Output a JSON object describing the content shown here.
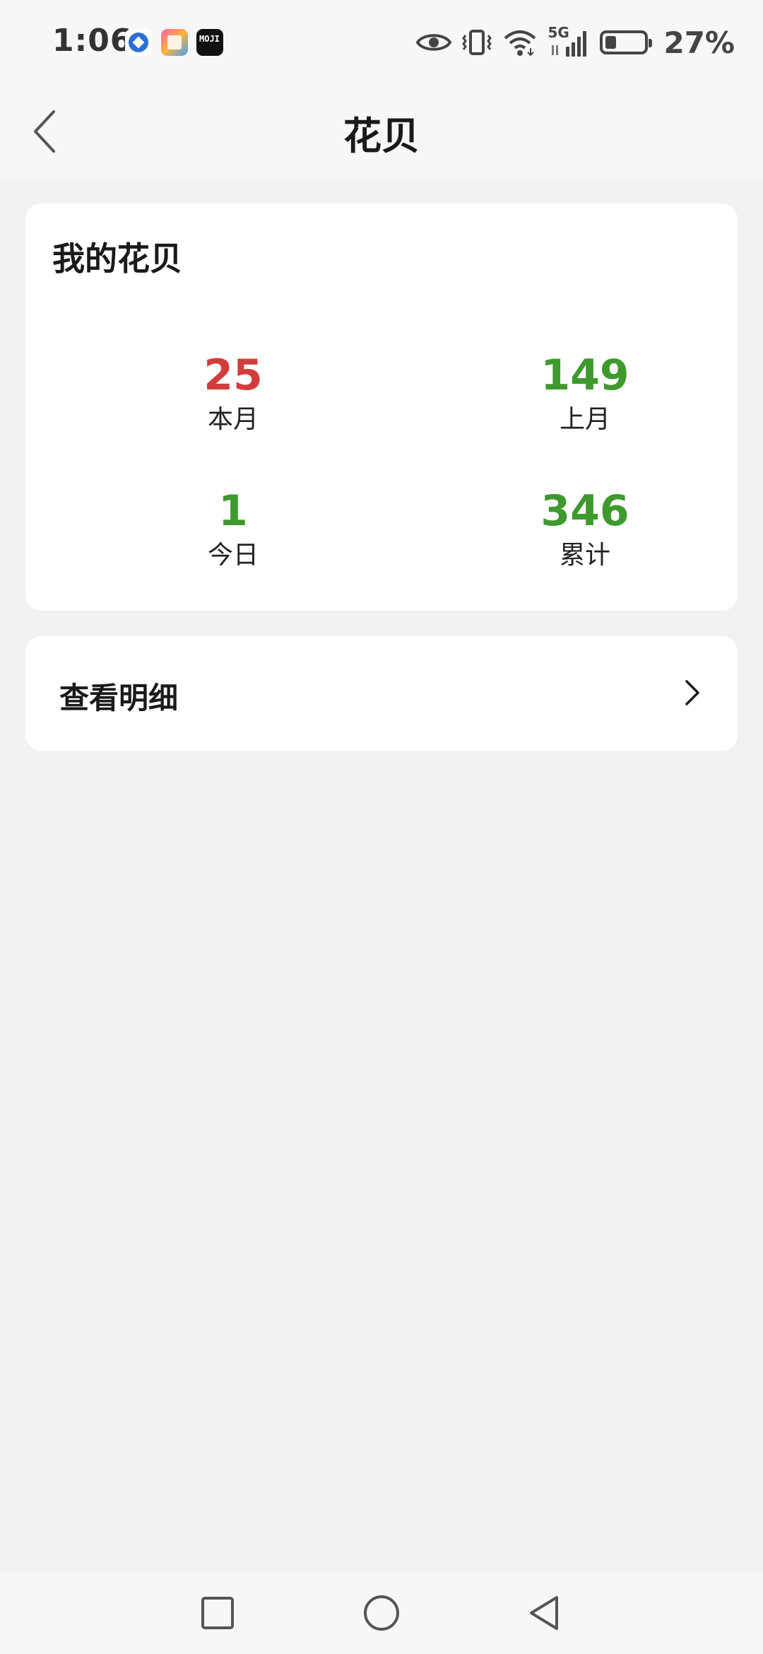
{
  "status_bar": {
    "time": "1:06",
    "network": "5G",
    "battery_text": "27%",
    "battery_level": 0.27,
    "app_badge_3": "MOJI",
    "icons": [
      "app-notification-icon-1",
      "app-notification-icon-2",
      "app-notification-icon-3",
      "eye-icon",
      "vibrate-icon",
      "wifi-icon",
      "signal-icon",
      "battery-icon"
    ]
  },
  "header": {
    "title": "花贝",
    "back_icon": "chevron-left-icon"
  },
  "stats_card": {
    "title": "我的花贝",
    "items": [
      {
        "value": "25",
        "label": "本月",
        "color": "#d23c3c"
      },
      {
        "value": "149",
        "label": "上月",
        "color": "#3f9a2d"
      },
      {
        "value": "1",
        "label": "今日",
        "color": "#3f9a2d"
      },
      {
        "value": "346",
        "label": "累计",
        "color": "#3f9a2d"
      }
    ]
  },
  "detail_row": {
    "label": "查看明细",
    "icon": "chevron-right-icon"
  },
  "nav_bar": {
    "icons": [
      "recent-apps-icon",
      "home-icon",
      "back-icon"
    ]
  }
}
